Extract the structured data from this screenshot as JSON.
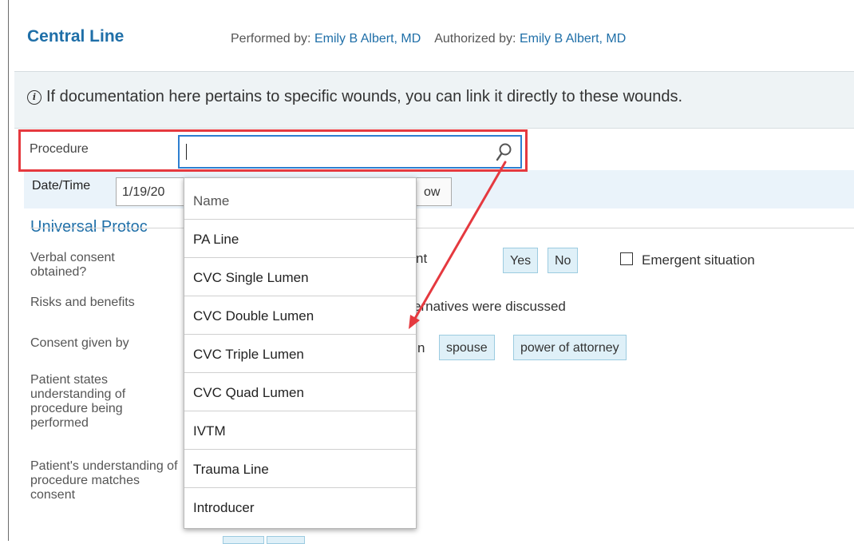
{
  "header": {
    "title": "Central Line",
    "performed_label": "Performed by:",
    "performed_by": "Emily B Albert, MD",
    "authorized_label": "Authorized by:",
    "authorized_by": "Emily B Albert, MD"
  },
  "banner": {
    "text": "If documentation here pertains to specific wounds, you can link it directly to these wounds.",
    "icon": "info-icon"
  },
  "procedure": {
    "label": "Procedure",
    "value": "",
    "icon": "search-icon"
  },
  "datetime": {
    "label": "Date/Time",
    "value": "1/19/20",
    "now_label": "ow"
  },
  "section": {
    "title": "Universal Protoc",
    "rows": [
      {
        "label": "Verbal consent obtained?",
        "fragment": "nt"
      },
      {
        "label": "Risks and benefits",
        "fragment": "ernatives were discussed"
      },
      {
        "label": "Consent given by",
        "fragment": "n"
      },
      {
        "label": "Patient states understanding of procedure being performed"
      },
      {
        "label": "Patient's understanding of procedure matches consent"
      }
    ],
    "buttons": {
      "yes": "Yes",
      "no": "No",
      "spouse": "spouse",
      "poa": "power of attorney"
    },
    "emergent_label": "Emergent situation"
  },
  "dropdown": {
    "header": "Name",
    "items": [
      "PA Line",
      "CVC Single Lumen",
      "CVC Double Lumen",
      "CVC Triple Lumen",
      "CVC Quad Lumen",
      "IVTM",
      "Trauma Line",
      "Introducer"
    ]
  },
  "colors": {
    "link": "#1f6fa8",
    "highlight": "#e5393f",
    "focus": "#2e7fd0",
    "banner_bg": "#eef3f5",
    "button_bg": "#dff0f8"
  }
}
